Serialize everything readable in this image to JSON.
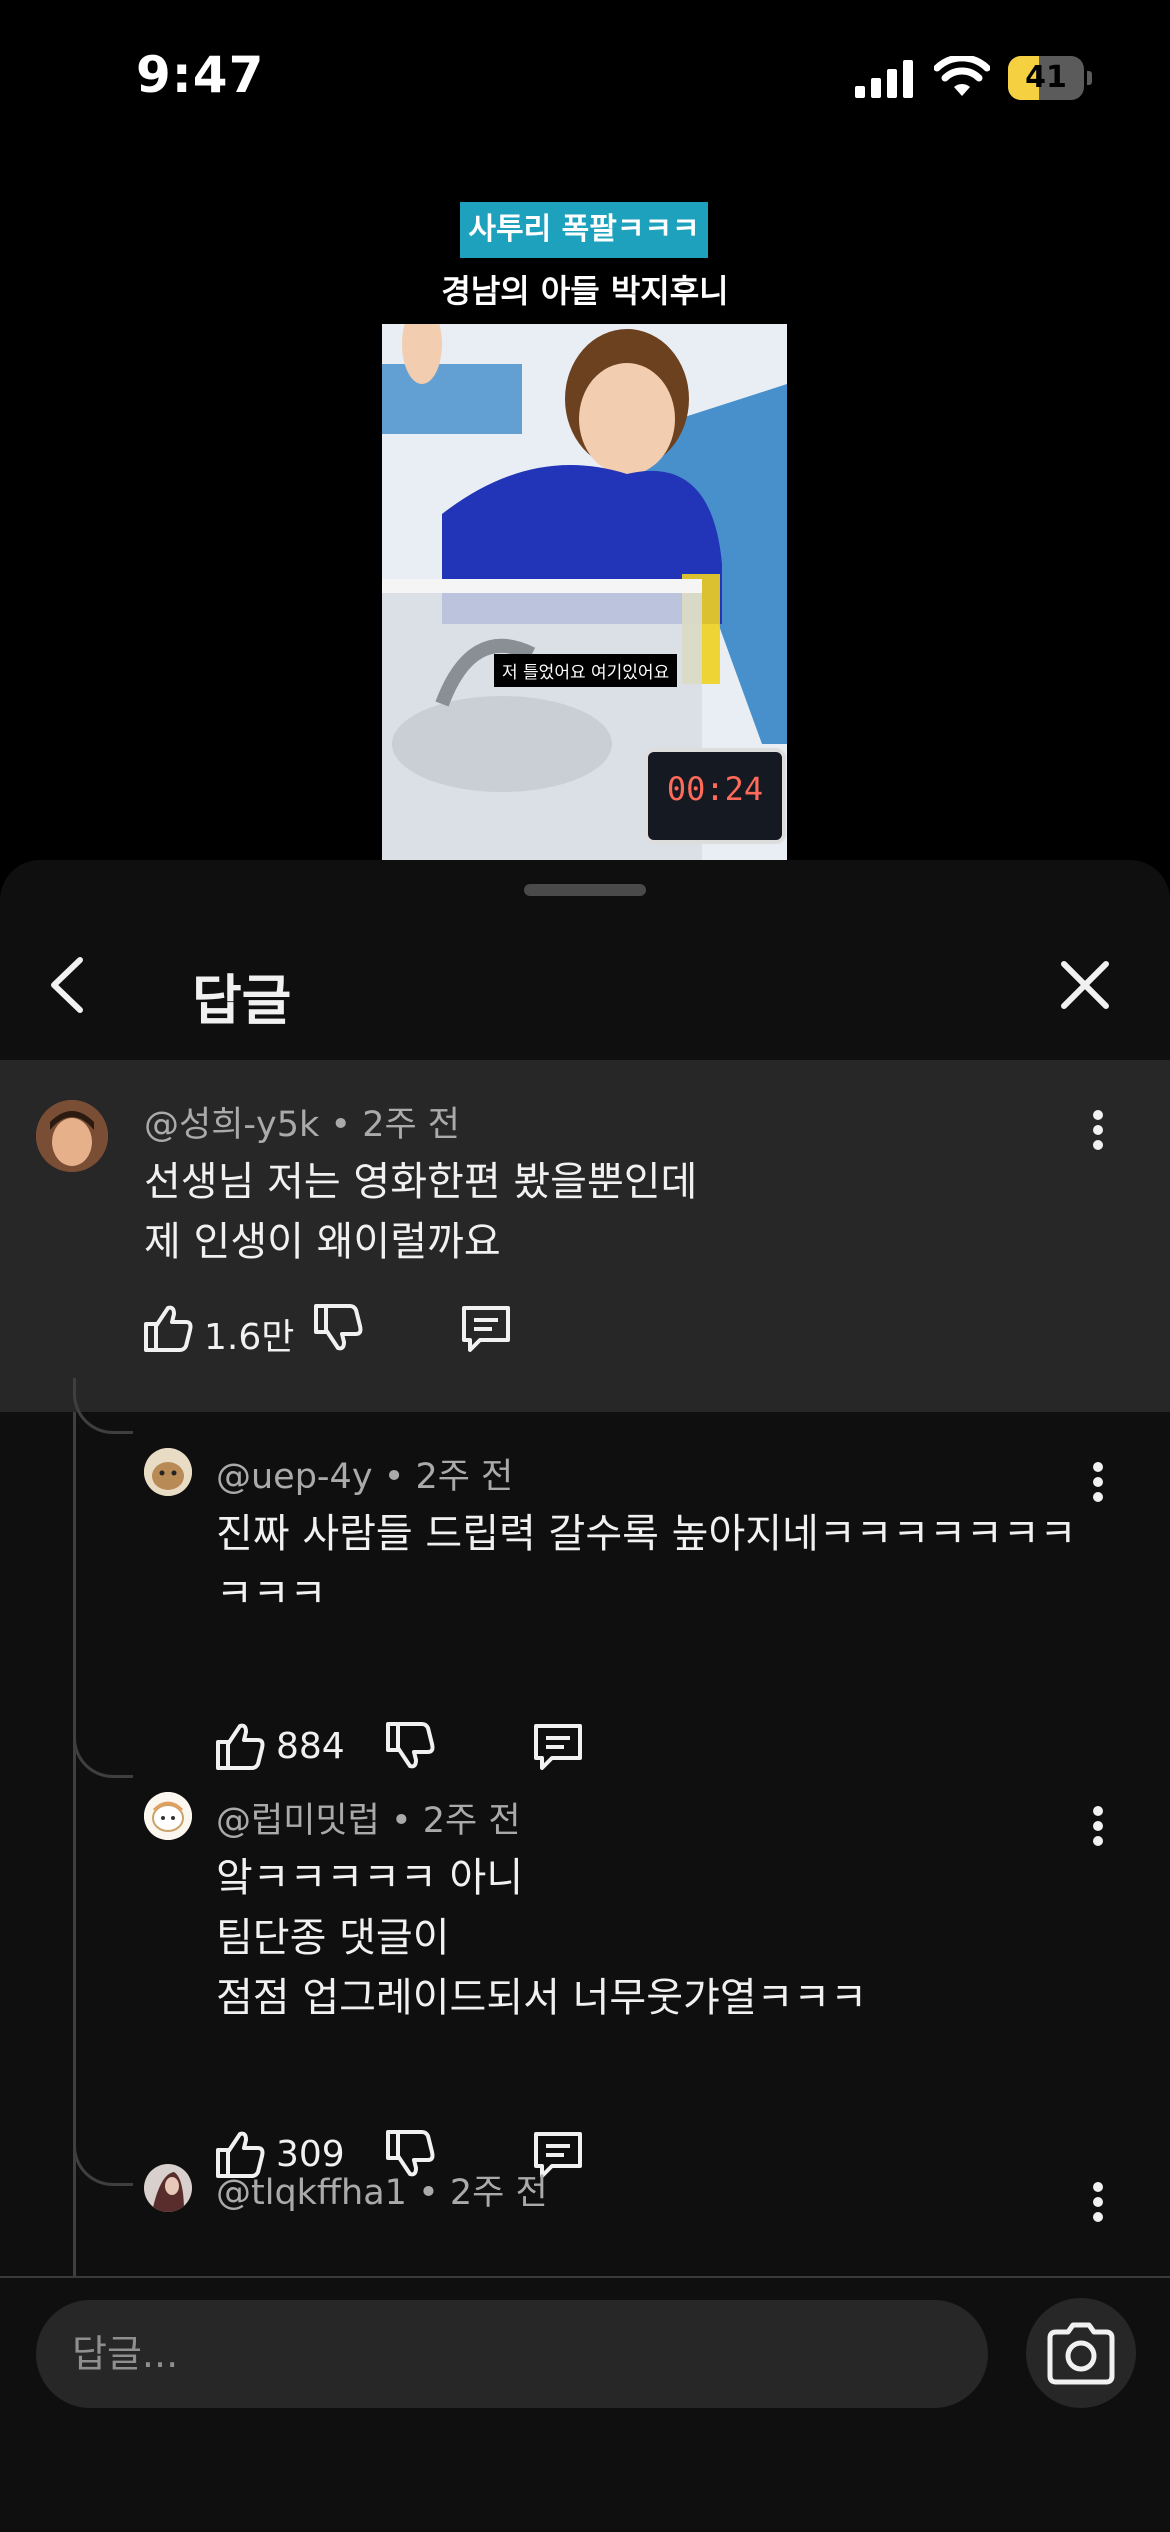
{
  "status_bar": {
    "time": "9:47",
    "battery_level": "41",
    "battery_fraction": 0.41
  },
  "video": {
    "caption_top": "사투리 폭팔ㅋㅋㅋ",
    "caption_sub": "경남의 아들 박지후니",
    "subtitle": "저 틀었어요 여기있어요",
    "timer": "00:24"
  },
  "sheet": {
    "title": "답글"
  },
  "parent_comment": {
    "author": "@성희-y5k",
    "time": "2주 전",
    "text": "선생님 저는 영화한편 봤을뿐인데\n제 인생이 왜이럴까요",
    "likes": "1.6만"
  },
  "replies": [
    {
      "author": "@uep-4y",
      "time": "2주 전",
      "text": "진짜 사람들 드립력 갈수록 높아지네ㅋㅋㅋㅋㅋㅋㅋ\nㅋㅋㅋ",
      "likes": "884"
    },
    {
      "author": "@럽미밋럽",
      "time": "2주 전",
      "text": "앜ㅋㅋㅋㅋㅋ 아니\n팀단종 댓글이\n점점 업그레이드되서 너무웃갸열ㅋㅋㅋ",
      "likes": "309"
    },
    {
      "author": "@tlqkffha1",
      "time": "2주 전",
      "text": "",
      "likes": ""
    }
  ],
  "footer": {
    "input_placeholder": "답글..."
  },
  "colors": {
    "background": "#0f0f0f",
    "highlight": "#272727",
    "caption_accent": "#1ea1bd",
    "battery": "#f5d142"
  }
}
